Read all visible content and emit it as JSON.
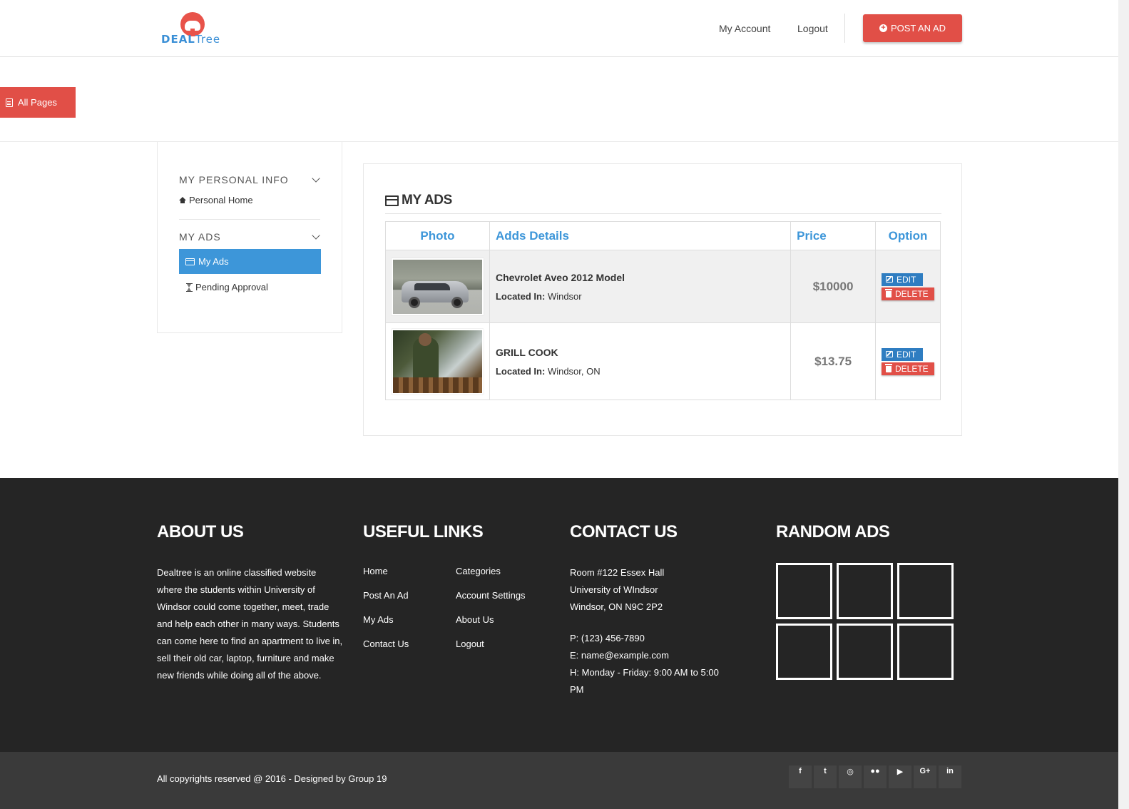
{
  "header": {
    "logo_text_deal": "DEAL",
    "logo_text_tree": "Tree",
    "nav": [
      "My Account",
      "Logout"
    ],
    "post_button": "POST AN AD"
  },
  "all_pages_tab": "All Pages",
  "sidebar": {
    "section1_title": "MY PERSONAL INFO",
    "personal_home": "Personal Home",
    "section2_title": "MY ADS",
    "my_ads": "My Ads",
    "pending_approval": "Pending Approval"
  },
  "main": {
    "title": "MY ADS",
    "columns": [
      "Photo",
      "Adds Details",
      "Price",
      "Option"
    ],
    "rows": [
      {
        "photo": "car-photo",
        "title": "Chevrolet Aveo 2012 Model",
        "located_label": "Located In:",
        "location": "Windsor",
        "price": "$10000",
        "edit": "EDIT",
        "delete": "DELETE"
      },
      {
        "photo": "grill-cook-photo",
        "title": "GRILL COOK",
        "located_label": "Located In:",
        "location": "Windsor, ON",
        "price": "$13.75",
        "edit": "EDIT",
        "delete": "DELETE"
      }
    ]
  },
  "footer": {
    "about_title": "ABOUT US",
    "about_text": "Dealtree is an online classified website where the students within University of Windsor could come together, meet, trade and help each other in many ways. Students can come here to find an apartment to live in, sell their old car, laptop, furniture and make new friends while doing all of the above.",
    "links_title": "USEFUL LINKS",
    "links": [
      "Home",
      "Categories",
      "Post An Ad",
      "Account Settings",
      "My Ads",
      "About Us",
      "Contact Us",
      "Logout"
    ],
    "contact_title": "CONTACT US",
    "contact_address": [
      "Room #122 Essex Hall",
      "University of WIndsor",
      "Windsor, ON N9C 2P2"
    ],
    "contact_phone": "P: (123) 456-7890",
    "contact_email": "E: name@example.com",
    "contact_hours": "H: Monday - Friday: 9:00 AM to 5:00 PM",
    "random_title": "RANDOM ADS",
    "copyright": "All copyrights reserved @ 2016 - Designed by Group 19",
    "social_icons": [
      "facebook-icon",
      "twitter-icon",
      "dribbble-icon",
      "flickr-icon",
      "youtube-icon",
      "google-plus-icon",
      "linkedin-icon"
    ],
    "social_glyphs": [
      "f",
      "t",
      "◎",
      "●●",
      "▶",
      "G+",
      "in"
    ]
  },
  "colors": {
    "accent_red": "#e14f47",
    "accent_blue": "#3d96d9",
    "footer_bg": "#252525"
  }
}
